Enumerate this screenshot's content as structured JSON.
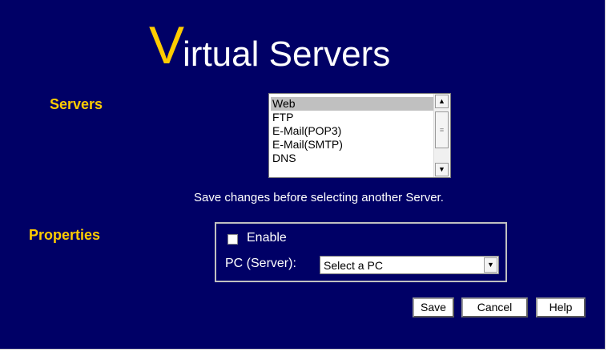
{
  "title": {
    "initial": "V",
    "rest": "irtual Servers"
  },
  "servers": {
    "label": "Servers",
    "items": [
      "Web",
      "FTP",
      "E-Mail(POP3)",
      "E-Mail(SMTP)",
      "DNS"
    ],
    "selected_index": 0
  },
  "note": "Save changes before selecting another Server.",
  "properties": {
    "label": "Properties",
    "enable_label": "Enable",
    "enable_checked": false,
    "pc_label": "PC (Server):",
    "pc_select_value": "Select a PC"
  },
  "buttons": {
    "save": "Save",
    "cancel": "Cancel",
    "help": "Help"
  },
  "colors": {
    "background": "#000066",
    "accent": "#ffcc00",
    "text": "#ffffff"
  },
  "icons": {
    "scroll_up": "arrow-up-icon",
    "scroll_down": "arrow-down-icon",
    "dropdown": "chevron-down-icon"
  }
}
